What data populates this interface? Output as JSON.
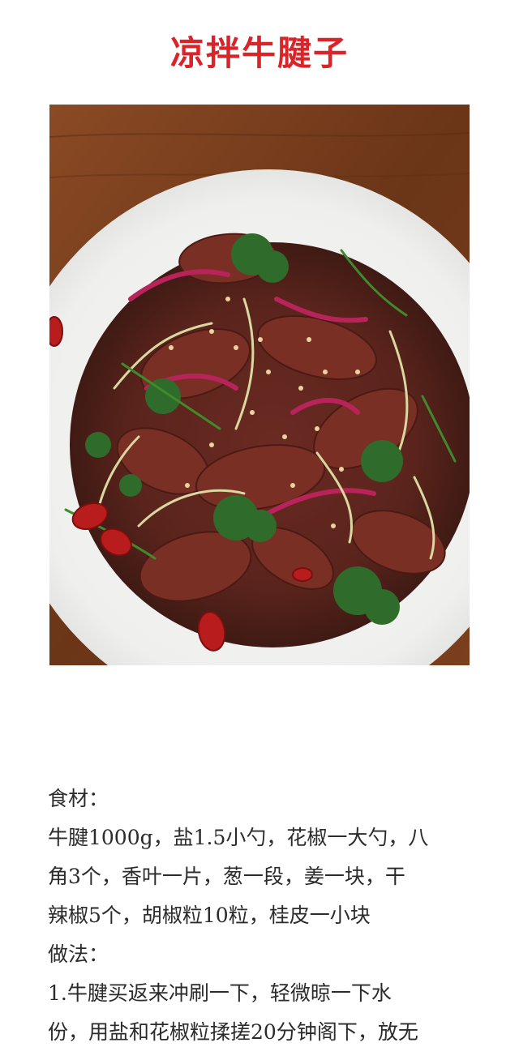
{
  "title": "凉拌牛腱子",
  "image": {
    "subject": "dish-photo"
  },
  "body": {
    "ingredients_heading": "食材：",
    "ingredients_lines": [
      "牛腱1000g，盐1.5小勺，花椒一大勺，八",
      "角3个，香叶一片，葱一段，姜一块，干",
      "辣椒5个，胡椒粒10粒，桂皮一小块"
    ],
    "method_heading": "做法：",
    "method_lines": [
      "1.牛腱买返来冲刷一下，轻微晾一下水",
      "份，用盐和花椒粒揉搓20分钟阁下，放无"
    ]
  }
}
